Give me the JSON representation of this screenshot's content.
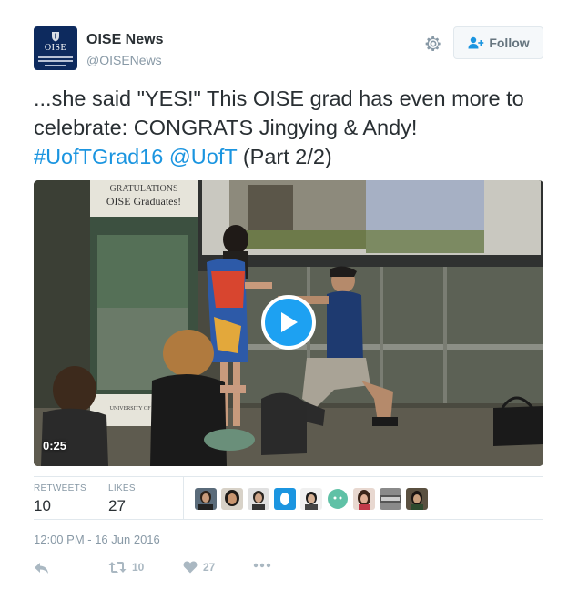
{
  "account": {
    "name": "OISE News",
    "handle": "@OISENews",
    "avatar_text": "OISE"
  },
  "follow_button": {
    "label": "Follow"
  },
  "tweet": {
    "text_part1": "...she said \"YES!\" This OISE grad has even more to celebrate: CONGRATS Jingying & Andy! ",
    "hashtag": "#UofTGrad16",
    "mention": "@UofT",
    "text_part2": "(Part 2/2)"
  },
  "media": {
    "duration": "0:25",
    "banner_text_1": "GRATULATIONS",
    "banner_text_2": "OISE Graduates!",
    "banner_text_3": "UNIVERSITY OF TORONTO"
  },
  "stats": {
    "retweets_label": "RETWEETS",
    "retweets": "10",
    "likes_label": "LIKES",
    "likes": "27"
  },
  "timestamp": "12:00 PM - 16 Jun 2016",
  "actions": {
    "retweet_count": "10",
    "like_count": "27"
  },
  "colors": {
    "link": "#1b95e0",
    "play_button": "#1da1f2",
    "muted": "#8899a6"
  },
  "icons": [
    "gear-icon",
    "follow-person-icon",
    "play-icon",
    "reply-icon",
    "retweet-icon",
    "like-icon",
    "more-icon"
  ]
}
